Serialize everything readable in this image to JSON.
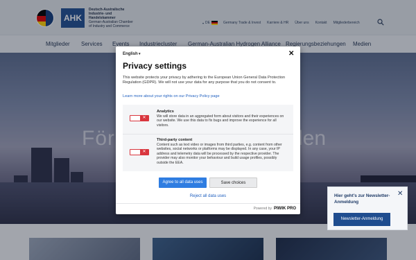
{
  "header": {
    "logo": {
      "abbr": "AHK",
      "line1": "Deutsch-Australische",
      "line2": "Industrie- und Handelskammer",
      "line3": "German-Australian Chamber",
      "line4": "of Industry and Commerce"
    },
    "lang": "DE",
    "topnav": [
      "Germany Trade & Invest",
      "Karriere & HR",
      "Über uns",
      "Kontakt",
      "Mitgliederbereich"
    ]
  },
  "mainnav": [
    "Mitglieder",
    "Services",
    "Events",
    "Industriecluster",
    "German-Australian Hydrogen Alliance",
    "Regierungsbeziehungen",
    "Medien"
  ],
  "hero": {
    "title_left": "För",
    "title_right": "len"
  },
  "dialog": {
    "language": "English",
    "close": "✕",
    "title": "Privacy settings",
    "description": "This website protects your privacy by adhering to the European Union General Data Protection Regulation (GDPR). We will not use your data for any purpose that you do not consent to.",
    "learn_more": "Learn more about your rights on our Privacy Policy page",
    "analytics": {
      "title": "Analytics",
      "text": "We will store data in an aggregated form about visitors and their experiences on our website. We use this data to fix bugs and improve the experience for all visitors."
    },
    "third_party": {
      "title": "Third-party content",
      "text": "Content such as text video or images from third parties, e.g. content from other websites, social networks or platforms may be displayed. In any case, your IP address and telemetry data will be processed by the respective provider. The provider may also monitor your behaviour and build usage profiles, possibly outside the EEA."
    },
    "toggle_mark": "✕",
    "agree_all": "Agree to all data uses",
    "save": "Save choices",
    "reject_all": "Reject all data uses",
    "powered_by": "Powered by",
    "brand": "PIWIK PRO"
  },
  "newsletter": {
    "text": "Hier geht’s zur Newsletter-Anmeldung",
    "close": "✕",
    "button": "Newsletter-Anmeldung"
  },
  "colors": {
    "primary": "#1f4d8f",
    "agree": "#2f7de1",
    "toggle_off": "#d9363e"
  }
}
